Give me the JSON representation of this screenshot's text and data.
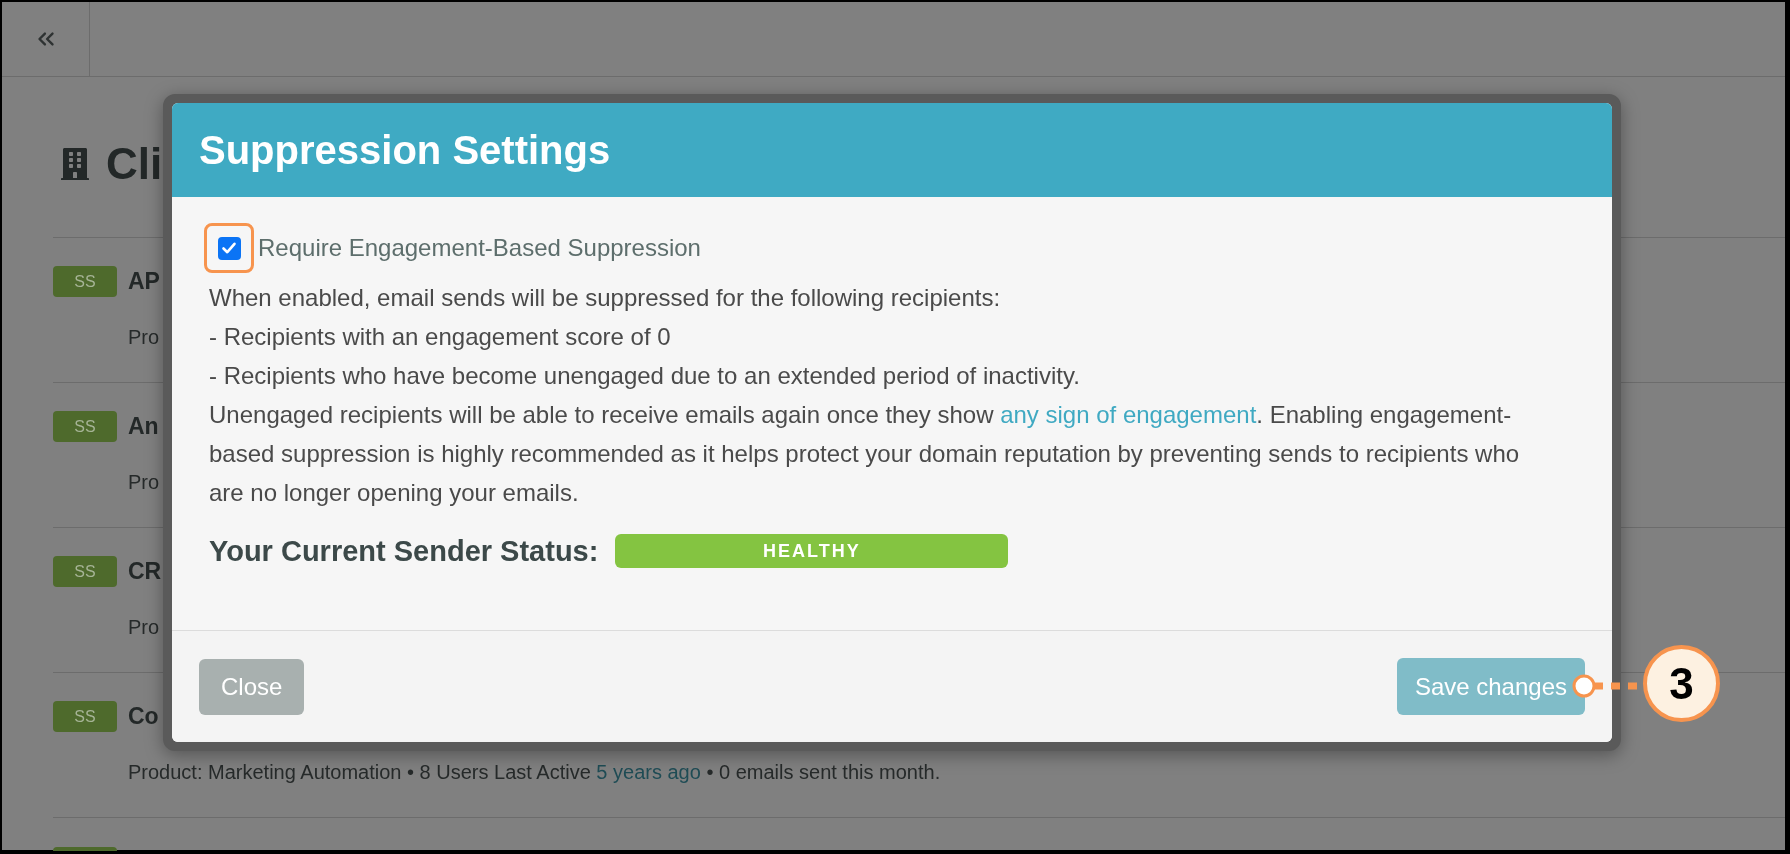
{
  "page": {
    "title": "Cli"
  },
  "clients": [
    {
      "badge": "SS",
      "name": "AP",
      "details": [
        {
          "kind": "text",
          "text": "Pro"
        }
      ]
    },
    {
      "badge": "SS",
      "name": "An",
      "details": [
        {
          "kind": "text",
          "text": "Pro"
        }
      ]
    },
    {
      "badge": "SS",
      "name": "CR",
      "details": [
        {
          "kind": "text",
          "text": "Pro"
        }
      ]
    },
    {
      "badge": "SS",
      "name": "Co",
      "details": [
        {
          "kind": "text",
          "text": "Product: Marketing Automation • 8 Users Last Active "
        },
        {
          "kind": "link",
          "text": "5 years ago"
        },
        {
          "kind": "text",
          "text": " • 0 emails sent this month."
        }
      ]
    }
  ],
  "dialog": {
    "title": "Suppression Settings",
    "checkbox": {
      "label": "Require Engagement-Based Suppression",
      "checked": true
    },
    "intro": "When enabled, email sends will be suppressed for the following recipients:",
    "bullets": [
      "- Recipients with an engagement score of 0",
      "- Recipients who have become unengaged due to an extended period of inactivity."
    ],
    "note": [
      {
        "kind": "text",
        "text": "Unengaged recipients will be able to receive emails again once they show "
      },
      {
        "kind": "link",
        "text": "any sign of engagement"
      },
      {
        "kind": "text",
        "text": ". Enabling engagement-based suppression is highly recommended as it helps protect your domain reputation by preventing sends to recipients who are no longer opening your emails."
      }
    ],
    "status": {
      "label": "Your Current Sender Status:",
      "value": "HEALTHY"
    },
    "buttons": [
      {
        "label": "Close",
        "kind": "secondary"
      },
      {
        "label": "Save changes",
        "kind": "primary"
      }
    ]
  },
  "callout": {
    "number": "3"
  }
}
